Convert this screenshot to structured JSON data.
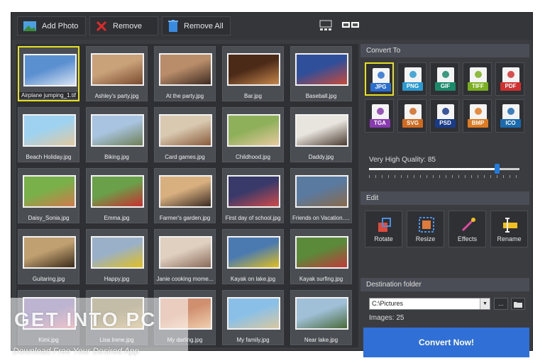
{
  "toolbar": {
    "add_photo": "Add Photo",
    "remove": "Remove",
    "remove_all": "Remove All",
    "icons": [
      "add-photo-icon",
      "remove-x-icon",
      "trash-icon",
      "single-view-icon",
      "grid-view-icon"
    ]
  },
  "photos": [
    {
      "name": "Airplane jumping_1.tif",
      "selected": true,
      "c1": "#5a8fd0",
      "c2": "#d7e3f2"
    },
    {
      "name": "Ashley's party.jpg",
      "selected": false,
      "c1": "#c9a27a",
      "c2": "#7a4a2f"
    },
    {
      "name": "At the party.jpg",
      "selected": false,
      "c1": "#b98d6a",
      "c2": "#3e2a20"
    },
    {
      "name": "Bar.jpg",
      "selected": false,
      "c1": "#4b2a18",
      "c2": "#c7874a"
    },
    {
      "name": "Baseball.jpg",
      "selected": false,
      "c1": "#2f4f9a",
      "c2": "#c94a3a"
    },
    {
      "name": "Beach Holiday.jpg",
      "selected": false,
      "c1": "#9fd2f0",
      "c2": "#e0c9a0"
    },
    {
      "name": "Biking.jpg",
      "selected": false,
      "c1": "#a9c4e0",
      "c2": "#6e7f55"
    },
    {
      "name": "Card games.jpg",
      "selected": false,
      "c1": "#d8c9b0",
      "c2": "#8a5a3a"
    },
    {
      "name": "Childhood.jpg",
      "selected": false,
      "c1": "#8fb05a",
      "c2": "#e8c9a0"
    },
    {
      "name": "Daddy.jpg",
      "selected": false,
      "c1": "#e8e4de",
      "c2": "#4a3a30"
    },
    {
      "name": "Daisy_Sonia.jpg",
      "selected": false,
      "c1": "#7ab04a",
      "c2": "#d07a4a"
    },
    {
      "name": "Emma.jpg",
      "selected": false,
      "c1": "#6aa04a",
      "c2": "#c83030"
    },
    {
      "name": "Farmer's garden.jpg",
      "selected": false,
      "c1": "#d8b080",
      "c2": "#3a2a22"
    },
    {
      "name": "First day of school.jpg",
      "selected": false,
      "c1": "#3a3a6a",
      "c2": "#d04a4a"
    },
    {
      "name": "Friends on Vacation.jpg",
      "selected": false,
      "c1": "#5a7aa0",
      "c2": "#8a6a4a"
    },
    {
      "name": "Guitaring.jpg",
      "selected": false,
      "c1": "#c0a070",
      "c2": "#3a2a1a"
    },
    {
      "name": "Happy.jpg",
      "selected": false,
      "c1": "#9ab0c8",
      "c2": "#e0c020"
    },
    {
      "name": "Janie cooking mome...",
      "selected": false,
      "c1": "#e0d0c0",
      "c2": "#8a6a5a"
    },
    {
      "name": "Kayak on lake.jpg",
      "selected": false,
      "c1": "#4a7ab0",
      "c2": "#e0c020"
    },
    {
      "name": "Kayak surfing.jpg",
      "selected": false,
      "c1": "#5a8a3a",
      "c2": "#c03a3a"
    },
    {
      "name": "Kimi.jpg",
      "selected": false,
      "c1": "#6a5a9a",
      "c2": "#d87a8a"
    },
    {
      "name": "Lisa Irene.jpg",
      "selected": false,
      "c1": "#7a6a3a",
      "c2": "#c0a060"
    },
    {
      "name": "My darling.jpg",
      "selected": false,
      "c1": "#d09070",
      "c2": "#f0d0b0"
    },
    {
      "name": "My family.jpg",
      "selected": false,
      "c1": "#8ac0e8",
      "c2": "#d8c8a0"
    },
    {
      "name": "Near lake.jpg",
      "selected": false,
      "c1": "#a0c0d8",
      "c2": "#4a6a3a"
    }
  ],
  "convert_to": {
    "title": "Convert To",
    "formats": [
      {
        "label": "JPG",
        "color": "#2a6fd0",
        "selected": true
      },
      {
        "label": "PNG",
        "color": "#2a9ad0",
        "selected": false
      },
      {
        "label": "GIF",
        "color": "#1a8a6a",
        "selected": false
      },
      {
        "label": "TIFF",
        "color": "#7ab020",
        "selected": false
      },
      {
        "label": "PDF",
        "color": "#d03030",
        "selected": false
      },
      {
        "label": "TGA",
        "color": "#8a3ab0",
        "selected": false
      },
      {
        "label": "SVG",
        "color": "#d06a20",
        "selected": false
      },
      {
        "label": "PSD",
        "color": "#1a3a8a",
        "selected": false
      },
      {
        "label": "BMP",
        "color": "#e07a20",
        "selected": false
      },
      {
        "label": "ICO",
        "color": "#1a6ab0",
        "selected": false
      }
    ],
    "quality_label": "Very High Quality: 85",
    "quality_value": 85
  },
  "edit": {
    "title": "Edit",
    "buttons": [
      {
        "label": "Rotate",
        "icon": "rotate-icon"
      },
      {
        "label": "Resize",
        "icon": "resize-icon"
      },
      {
        "label": "Effects",
        "icon": "effects-wand-icon"
      },
      {
        "label": "Rename",
        "icon": "rename-icon"
      }
    ]
  },
  "destination": {
    "title": "Destination folder",
    "path": "C:\\Pictures",
    "browse": "...",
    "images_count": "Images: 25"
  },
  "convert_now": "Convert Now!",
  "watermark": {
    "line1": "GET INTO PC",
    "line2": "Download Free Your Desired App"
  }
}
